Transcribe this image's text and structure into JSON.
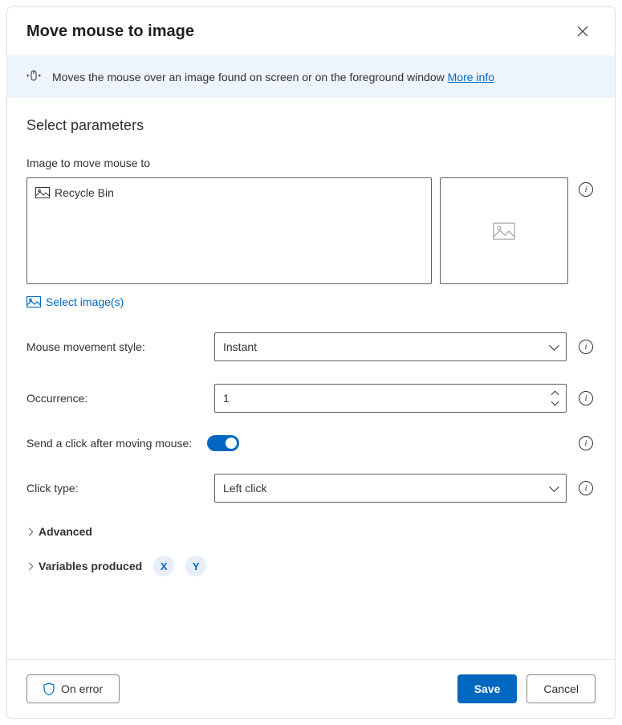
{
  "dialog": {
    "title": "Move mouse to image",
    "banner_text": "Moves the mouse over an image found on screen or on the foreground window",
    "more_info_label": "More info"
  },
  "params": {
    "section_title": "Select parameters",
    "image_field_label": "Image to move mouse to",
    "image_entry_name": "Recycle Bin",
    "select_images_label": "Select image(s)",
    "movement_style_label": "Mouse movement style:",
    "movement_style_value": "Instant",
    "occurrence_label": "Occurrence:",
    "occurrence_value": "1",
    "send_click_label": "Send a click after moving mouse:",
    "send_click_value": true,
    "click_type_label": "Click type:",
    "click_type_value": "Left click",
    "advanced_label": "Advanced",
    "variables_label": "Variables produced",
    "variable_x": "X",
    "variable_y": "Y"
  },
  "footer": {
    "on_error_label": "On error",
    "save_label": "Save",
    "cancel_label": "Cancel"
  }
}
